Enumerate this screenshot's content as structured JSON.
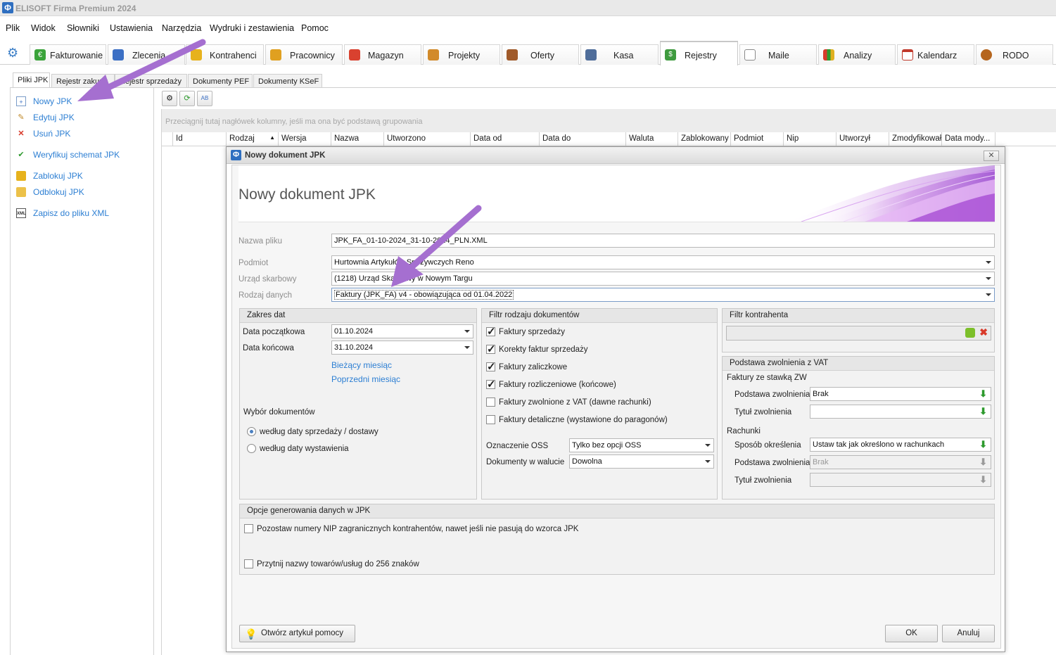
{
  "app": {
    "title": "ELISOFT Firma Premium 2024",
    "logo_char": "Φ"
  },
  "menu": [
    "Plik",
    "Widok",
    "Słowniki",
    "Ustawienia",
    "Narzędzia",
    "Wydruki i zestawienia",
    "Pomoc"
  ],
  "ribbon": {
    "tabs": [
      {
        "label": "Fakturowanie",
        "icon": "euro-icon",
        "color": "#3aa33a"
      },
      {
        "label": "Zlecenia",
        "icon": "documents-icon",
        "color": "#3b6fc4"
      },
      {
        "label": "Kontrahenci",
        "icon": "people-icon",
        "color": "#e7b21c"
      },
      {
        "label": "Pracownicy",
        "icon": "workers-icon",
        "color": "#e0a020"
      },
      {
        "label": "Magazyn",
        "icon": "bags-icon",
        "color": "#d9412f"
      },
      {
        "label": "Projekty",
        "icon": "pencil-icon",
        "color": "#d28a2a"
      },
      {
        "label": "Oferty",
        "icon": "briefcase-icon",
        "color": "#a05a2a"
      },
      {
        "label": "Kasa",
        "icon": "cash-register-icon",
        "color": "#4f6d9a"
      },
      {
        "label": "Rejestry",
        "icon": "register-icon",
        "color": "#3f9b3f"
      },
      {
        "label": "Maile",
        "icon": "mail-icon",
        "color": "#8a8a8a"
      },
      {
        "label": "Analizy",
        "icon": "bar-chart-icon",
        "color": "#d83a2a"
      },
      {
        "label": "Kalendarz",
        "icon": "calendar-icon",
        "color": "#c0392b"
      },
      {
        "label": "RODO",
        "icon": "person-icon",
        "color": "#b5651d"
      }
    ],
    "active": "Rejestry"
  },
  "subtabs": [
    "Pliki JPK",
    "Rejestr zakupu",
    "Rejestr sprzedaży",
    "Dokumenty PEF",
    "Dokumenty KSeF"
  ],
  "left": {
    "items": [
      {
        "label": "Nowy JPK",
        "icon": "new-file-icon"
      },
      {
        "label": "Edytuj JPK",
        "icon": "edit-icon"
      },
      {
        "label": "Usuń JPK",
        "icon": "delete-file-icon"
      },
      {
        "label": "Weryfikuj schemat JPK",
        "icon": "verify-icon"
      },
      {
        "label": "Zablokuj JPK",
        "icon": "lock-icon"
      },
      {
        "label": "Odblokuj JPK",
        "icon": "unlock-icon"
      },
      {
        "label": "Zapisz do pliku XML",
        "icon": "xml-icon"
      }
    ]
  },
  "grid": {
    "group_hint": "Przeciągnij tutaj nagłówek kolumny, jeśli ma ona być podstawą grupowania",
    "columns": [
      "Id",
      "Rodzaj",
      "Wersja",
      "Nazwa",
      "Utworzono",
      "Data od",
      "Data do",
      "Waluta",
      "Zablokowany",
      "Podmiot",
      "Nip",
      "Utworzył",
      "Zmodyfikował",
      "Data mody..."
    ]
  },
  "dialog": {
    "title": "Nowy dokument JPK",
    "heading": "Nowy dokument JPK",
    "fields": {
      "nazwa_pliku": {
        "label": "Nazwa pliku",
        "value": "JPK_FA_01-10-2024_31-10-2024_PLN.XML"
      },
      "podmiot": {
        "label": "Podmiot",
        "value": "Hurtownia Artykułów Spożywczych Reno"
      },
      "urzad": {
        "label": "Urząd skarbowy",
        "value": "(1218) Urząd Skarbowy w Nowym Targu"
      },
      "rodzaj": {
        "label": "Rodzaj danych",
        "value": "Faktury (JPK_FA) v4 - obowiązująca od 01.04.2022"
      }
    },
    "zakres": {
      "title": "Zakres dat",
      "start_label": "Data początkowa",
      "start_value": "01.10.2024",
      "end_label": "Data końcowa",
      "end_value": "31.10.2024",
      "link_current": "Bieżący miesiąc",
      "link_prev": "Poprzedni miesiąc",
      "wybor_label": "Wybór dokumentów",
      "radio1": "według daty sprzedaży / dostawy",
      "radio2": "według daty wystawienia"
    },
    "filtr": {
      "title": "Filtr rodzaju dokumentów",
      "checks": [
        {
          "label": "Faktury sprzedaży",
          "checked": true
        },
        {
          "label": "Korekty faktur sprzedaży",
          "checked": true
        },
        {
          "label": "Faktury zaliczkowe",
          "checked": true
        },
        {
          "label": "Faktury rozliczeniowe (końcowe)",
          "checked": true
        },
        {
          "label": "Faktury zwolnione z VAT (dawne rachunki)",
          "checked": false
        },
        {
          "label": "Faktury detaliczne (wystawione do paragonów)",
          "checked": false
        }
      ],
      "oss_label": "Oznaczenie OSS",
      "oss_value": "Tylko bez opcji OSS",
      "waluta_label": "Dokumenty w walucie",
      "waluta_value": "Dowolna"
    },
    "kontrahent": {
      "title": "Filtr kontrahenta"
    },
    "vat": {
      "title": "Podstawa zwolnienia z VAT",
      "zw_label": "Faktury ze stawką ZW",
      "podstawa_label": "Podstawa zwolnienia",
      "podstawa_value": "Brak",
      "tytul_label": "Tytuł zwolnienia",
      "tytul_value": "",
      "rachunki_label": "Rachunki",
      "sposob_label": "Sposób określenia",
      "sposob_value": "Ustaw tak jak określono w rachunkach",
      "r_podstawa_label": "Podstawa zwolnienia",
      "r_podstawa_value": "Brak",
      "r_tytul_label": "Tytuł zwolnienia",
      "r_tytul_value": ""
    },
    "opcje": {
      "title": "Opcje generowania danych w JPK",
      "opt1": "Pozostaw numery NIP zagranicznych kontrahentów, nawet jeśli nie pasują do wzorca JPK",
      "opt2": "Przytnij nazwy towarów/usług do 256 znaków"
    },
    "help_button": "Otwórz artykuł pomocy",
    "ok_button": "OK",
    "cancel_button": "Anuluj"
  },
  "colors": {
    "link": "#2d7fd3",
    "annotation_arrow": "#a56fd0",
    "active_tab_accent": "#5aa832"
  }
}
